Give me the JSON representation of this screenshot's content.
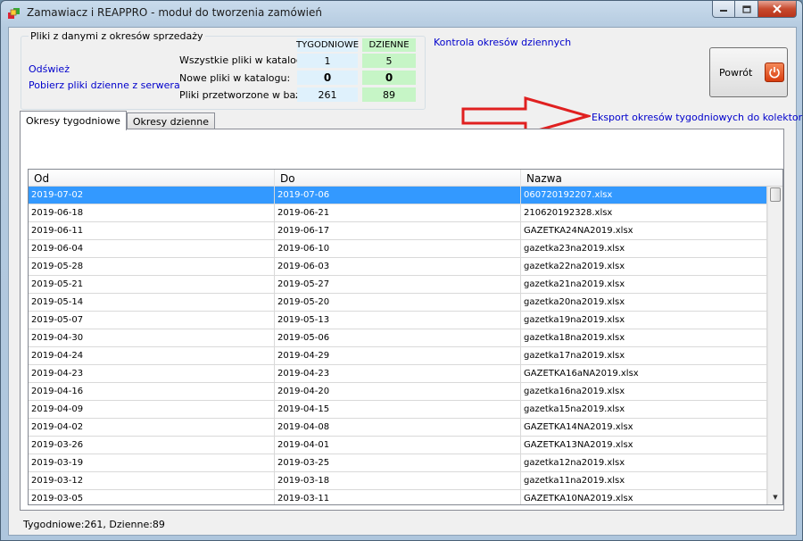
{
  "window": {
    "title": "Zamawiacz i REAPPRO - moduł do tworzenia zamówień"
  },
  "group": {
    "title": "Pliki z danymi z okresów sprzedaży",
    "refresh_link": "Odśwież",
    "fetch_link": "Pobierz pliki dzienne z serwera",
    "col_weekly": "TYGODNIOWE",
    "col_daily": "DZIENNE",
    "rows": [
      {
        "label": "Wszystkie pliki w katalogu:",
        "weekly": "1",
        "daily": "5"
      },
      {
        "label": "Nowe pliki w katalogu:",
        "weekly": "0",
        "daily": "0"
      },
      {
        "label": "Pliki przetworzone w bazie:",
        "weekly": "261",
        "daily": "89"
      }
    ]
  },
  "control_link": "Kontrola okresów dziennych",
  "export_link": "Eksport okresów tygodniowych do kolektora",
  "back_button": "Powrót",
  "tabs": [
    {
      "label": "Okresy tygodniowe",
      "active": true
    },
    {
      "label": "Okresy dzienne",
      "active": false
    }
  ],
  "grid": {
    "columns": [
      "Od",
      "Do",
      "Nazwa"
    ],
    "rows": [
      [
        "2019-07-02",
        "2019-07-06",
        "060720192207.xlsx"
      ],
      [
        "2019-06-18",
        "2019-06-21",
        "210620192328.xlsx"
      ],
      [
        "2019-06-11",
        "2019-06-17",
        "GAZETKA24NA2019.xlsx"
      ],
      [
        "2019-06-04",
        "2019-06-10",
        "gazetka23na2019.xlsx"
      ],
      [
        "2019-05-28",
        "2019-06-03",
        "gazetka22na2019.xlsx"
      ],
      [
        "2019-05-21",
        "2019-05-27",
        "gazetka21na2019.xlsx"
      ],
      [
        "2019-05-14",
        "2019-05-20",
        "gazetka20na2019.xlsx"
      ],
      [
        "2019-05-07",
        "2019-05-13",
        "gazetka19na2019.xlsx"
      ],
      [
        "2019-04-30",
        "2019-05-06",
        "gazetka18na2019.xlsx"
      ],
      [
        "2019-04-24",
        "2019-04-29",
        "gazetka17na2019.xlsx"
      ],
      [
        "2019-04-23",
        "2019-04-23",
        "GAZETKA16aNA2019.xlsx"
      ],
      [
        "2019-04-16",
        "2019-04-20",
        "gazetka16na2019.xlsx"
      ],
      [
        "2019-04-09",
        "2019-04-15",
        "gazetka15na2019.xlsx"
      ],
      [
        "2019-04-02",
        "2019-04-08",
        "GAZETKA14NA2019.xlsx"
      ],
      [
        "2019-03-26",
        "2019-04-01",
        "GAZETKA13NA2019.xlsx"
      ],
      [
        "2019-03-19",
        "2019-03-25",
        "gazetka12na2019.xlsx"
      ],
      [
        "2019-03-12",
        "2019-03-18",
        "gazetka11na2019.xlsx"
      ],
      [
        "2019-03-05",
        "2019-03-11",
        "GAZETKA10NA2019.xlsx"
      ]
    ]
  },
  "status": "Tygodniowe:261, Dzienne:89",
  "colors": {
    "selection": "#3399ff",
    "link": "#0000cc",
    "arrow": "#e02020"
  }
}
